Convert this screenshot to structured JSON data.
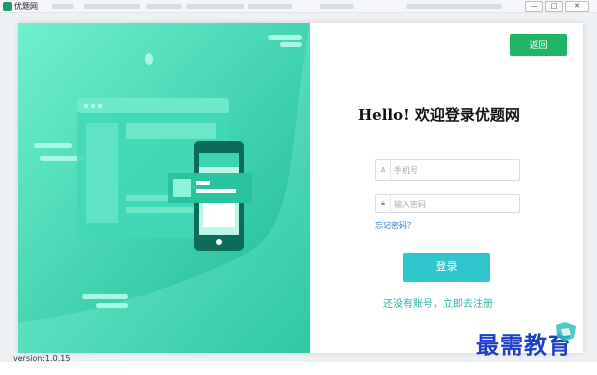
{
  "window": {
    "title": "优题网",
    "controls": [
      "—",
      "□",
      "✕"
    ]
  },
  "hero": {
    "illustration": "browser-window-and-phone",
    "colors": {
      "gradient_start": "#5fe5c6",
      "gradient_end": "#1fbf9b"
    }
  },
  "form": {
    "back_label": "返回",
    "heading": "Hello! 欢迎登录优题网",
    "phone": {
      "placeholder": "手机号",
      "value": "",
      "icon": "user-icon"
    },
    "password": {
      "placeholder": "输入密码",
      "value": "",
      "icon": "lock-icon"
    },
    "forgot_label": "忘记密码？",
    "login_label": "登录",
    "register_label": "还没有账号，立即去注册"
  },
  "footer": {
    "version": "version:1.0.15"
  },
  "watermark": {
    "text": "最需教育"
  },
  "colors": {
    "back_button": "#1fb565",
    "login_button": "#2fc5cc",
    "register_link": "#2bb5a5",
    "forgot_link": "#2c79c9"
  }
}
